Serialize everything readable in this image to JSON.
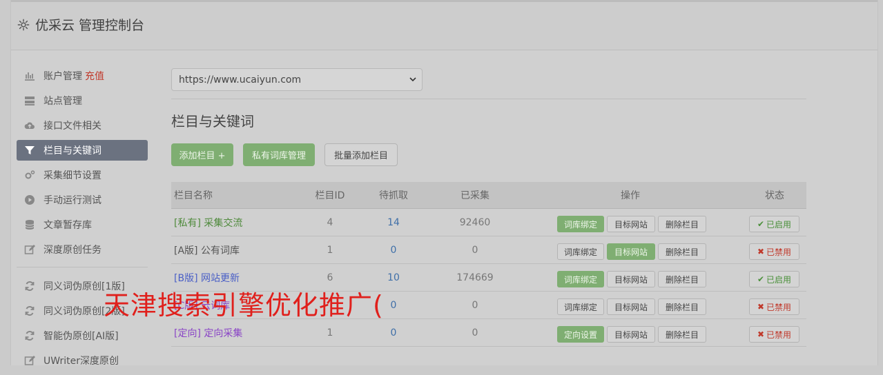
{
  "app": {
    "title": "优采云 管理控制台"
  },
  "sidebar": {
    "items": [
      {
        "label": "账户管理",
        "extra": "充值",
        "icon": "bar-chart-icon"
      },
      {
        "label": "站点管理",
        "icon": "server-icon"
      },
      {
        "label": "接口文件相关",
        "icon": "cloud-upload-icon"
      },
      {
        "label": "栏目与关键词",
        "icon": "filter-icon",
        "active": true
      },
      {
        "label": "采集细节设置",
        "icon": "gears-icon"
      },
      {
        "label": "手动运行测试",
        "icon": "play-icon"
      },
      {
        "label": "文章暂存库",
        "icon": "database-icon"
      },
      {
        "label": "深度原创任务",
        "icon": "edit-icon"
      }
    ],
    "items2": [
      {
        "label": "同义词伪原创[1版]",
        "icon": "refresh-icon"
      },
      {
        "label": "同义词伪原创[2版]",
        "icon": "refresh-icon"
      },
      {
        "label": "智能伪原创[AI版]",
        "icon": "refresh-icon"
      },
      {
        "label": "UWriter深度原创",
        "icon": "edit-icon"
      }
    ]
  },
  "site_select": {
    "value": "https://www.ucaiyun.com"
  },
  "section": {
    "title": "栏目与关键词"
  },
  "toolbar": {
    "add_label": "添加栏目 +",
    "private_lib_label": "私有词库管理",
    "batch_add_label": "批量添加栏目"
  },
  "table": {
    "headers": {
      "name": "栏目名称",
      "id": "栏目ID",
      "pending": "待抓取",
      "collected": "已采集",
      "ops": "操作",
      "status": "状态"
    },
    "rows": [
      {
        "tag": "[私有]",
        "name": "采集交流",
        "tag_color": "green",
        "id": "4",
        "pending": "14",
        "pending_color": "blue",
        "collected": "92460",
        "op1": "词库绑定",
        "op1_green": true,
        "op2": "目标网站",
        "op2_green": false,
        "op3": "删除栏目",
        "status": "已启用",
        "status_on": true
      },
      {
        "tag": "[A版]",
        "name": "公有词库",
        "tag_color": "dark",
        "id": "1",
        "pending": "0",
        "pending_color": "blue",
        "collected": "0",
        "op1": "词库绑定",
        "op1_green": false,
        "op2": "目标网站",
        "op2_green": true,
        "op3": "删除栏目",
        "status": "已禁用",
        "status_on": false
      },
      {
        "tag": "[B版]",
        "name": "网站更新",
        "tag_color": "blue",
        "id": "6",
        "pending": "10",
        "pending_color": "blue",
        "collected": "174669",
        "op1": "词库绑定",
        "op1_green": true,
        "op2": "目标网站",
        "op2_green": false,
        "op3": "删除栏目",
        "status": "已启用",
        "status_on": true
      },
      {
        "tag": "[C版]",
        "name": "云词库",
        "tag_color": "purple",
        "id": "",
        "pending": "0",
        "pending_color": "blue",
        "collected": "0",
        "op1": "词库绑定",
        "op1_green": false,
        "op2": "目标网站",
        "op2_green": false,
        "op3": "删除栏目",
        "status": "已禁用",
        "status_on": false
      },
      {
        "tag": "[定向]",
        "name": "定向采集",
        "tag_color": "purple",
        "id": "1",
        "pending": "0",
        "pending_color": "blue",
        "collected": "0",
        "op1": "定向设置",
        "op1_green": true,
        "op2": "目标网站",
        "op2_green": false,
        "op3": "删除栏目",
        "status": "已禁用",
        "status_on": false
      }
    ]
  },
  "overlay_text": "天津搜索引擎优化推广(",
  "colors": {
    "accent_green": "#7fae72",
    "active_nav": "#6b7280",
    "danger": "#c0392b"
  }
}
